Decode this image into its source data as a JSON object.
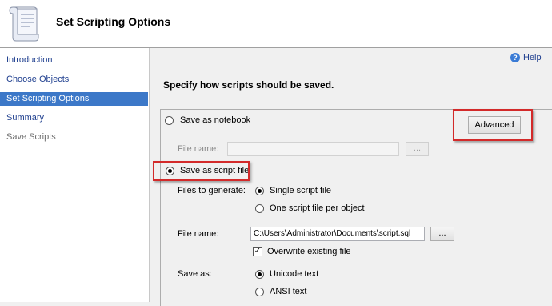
{
  "header": {
    "title": "Set Scripting Options"
  },
  "nav": {
    "items": [
      {
        "label": "Introduction"
      },
      {
        "label": "Choose Objects"
      },
      {
        "label": "Set Scripting Options"
      },
      {
        "label": "Summary"
      },
      {
        "label": "Save Scripts"
      }
    ]
  },
  "help": {
    "label": "Help"
  },
  "main": {
    "instruction": "Specify how scripts should be saved.",
    "save_notebook_label": "Save as notebook",
    "advanced_label": "Advanced",
    "notebook_filename_label": "File name:",
    "notebook_filename_value": "",
    "browse_label": "...",
    "save_script_label": "Save as script file",
    "files_to_generate_label": "Files to generate:",
    "single_file_label": "Single script file",
    "one_per_object_label": "One script file per object",
    "filename_label": "File name:",
    "filename_value": "C:\\Users\\Administrator\\Documents\\script.sql",
    "overwrite_label": "Overwrite existing file",
    "save_as_label": "Save as:",
    "unicode_label": "Unicode text",
    "ansi_label": "ANSI text"
  },
  "state": {
    "save_mode": "script_file",
    "files_to_generate": "single",
    "overwrite_checked": true,
    "save_as": "unicode"
  },
  "colors": {
    "nav_selected": "#3c78c8",
    "highlight_box": "#d32a2a",
    "link": "#1f3f8f"
  }
}
